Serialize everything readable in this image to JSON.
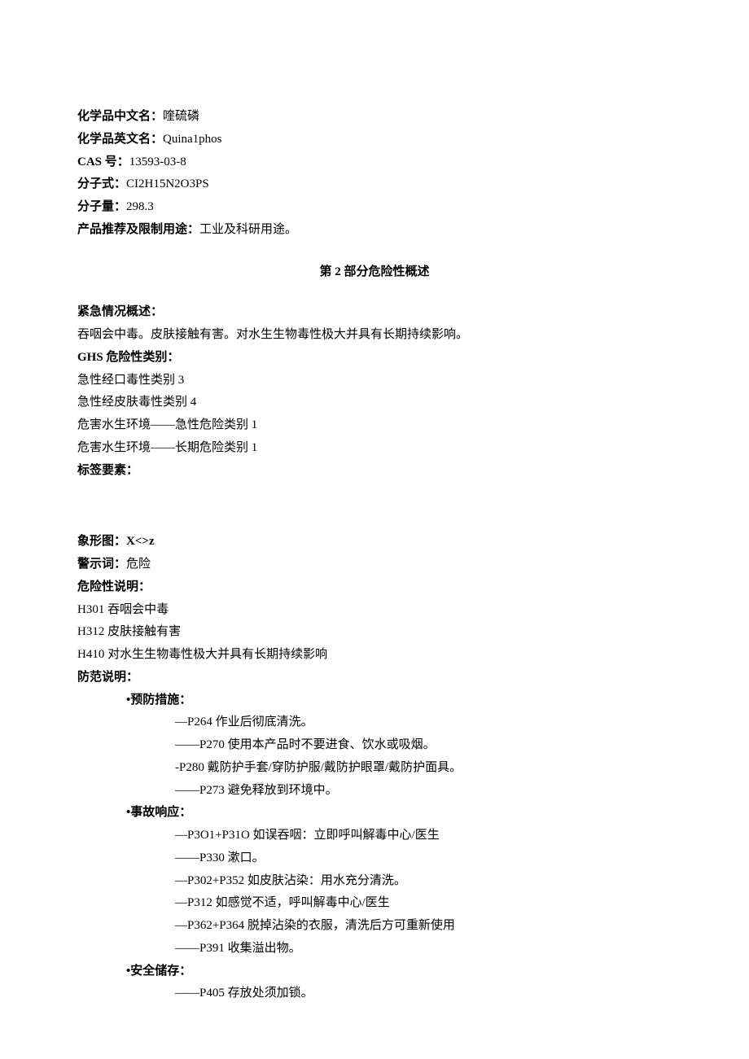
{
  "identity": {
    "name_cn_label": "化学品中文名：",
    "name_cn": "喹硫磷",
    "name_en_label": "化学品英文名：",
    "name_en": "Quina1phos",
    "cas_label": "CAS 号：",
    "cas": "13593-03-8",
    "formula_label": "分子式：",
    "formula": "CI2H15N2O3PS",
    "mw_label": "分子量：",
    "mw": "298.3",
    "use_label": "产品推荐及限制用途：",
    "use": "工业及科研用途。"
  },
  "section2_title": "第 2 部分危险性概述",
  "emergency": {
    "label": "紧急情况概述：",
    "text": "吞咽会中毒。皮肤接触有害。对水生生物毒性极大并具有长期持续影响。"
  },
  "ghs": {
    "label": "GHS 危险性类别：",
    "items": [
      "急性经口毒性类别 3",
      "急性经皮肤毒性类别 4",
      "危害水生环境——急性危险类别 1",
      "危害水生环境——长期危险类别 1"
    ]
  },
  "label_elements": "标签要素：",
  "pictogram": {
    "label": "象形图：",
    "value": "X<>z"
  },
  "signal": {
    "label": "警示词：",
    "value": "危险"
  },
  "hazard": {
    "label": "危险性说明：",
    "items": [
      "H301 吞咽会中毒",
      "H312 皮肤接触有害",
      "H410 对水生生物毒性极大并具有长期持续影响"
    ]
  },
  "precaution": {
    "label": "防范说明：",
    "prevention": {
      "label": "•预防措施：",
      "items": [
        "—P264 作业后彻底清洗。",
        "——P270 使用本产品时不要进食、饮水或吸烟。",
        "-P280 戴防护手套/穿防护服/戴防护眼罩/戴防护面具。",
        "——P273 避免释放到环境中。"
      ]
    },
    "response": {
      "label": "•事故响应：",
      "items": [
        "—P3O1+P31O 如误吞咽：立即呼叫解毒中心/医生",
        "——P330 漱口。",
        "—P302+P352 如皮肤沾染：用水充分清洗。",
        "—P312 如感觉不适，呼叫解毒中心/医生",
        "—P362+P364 脱掉沾染的衣服，清洗后方可重新使用",
        "——P391 收集溢出物。"
      ]
    },
    "storage": {
      "label": "•安全储存：",
      "items": [
        "——P405 存放处须加锁。"
      ]
    }
  }
}
